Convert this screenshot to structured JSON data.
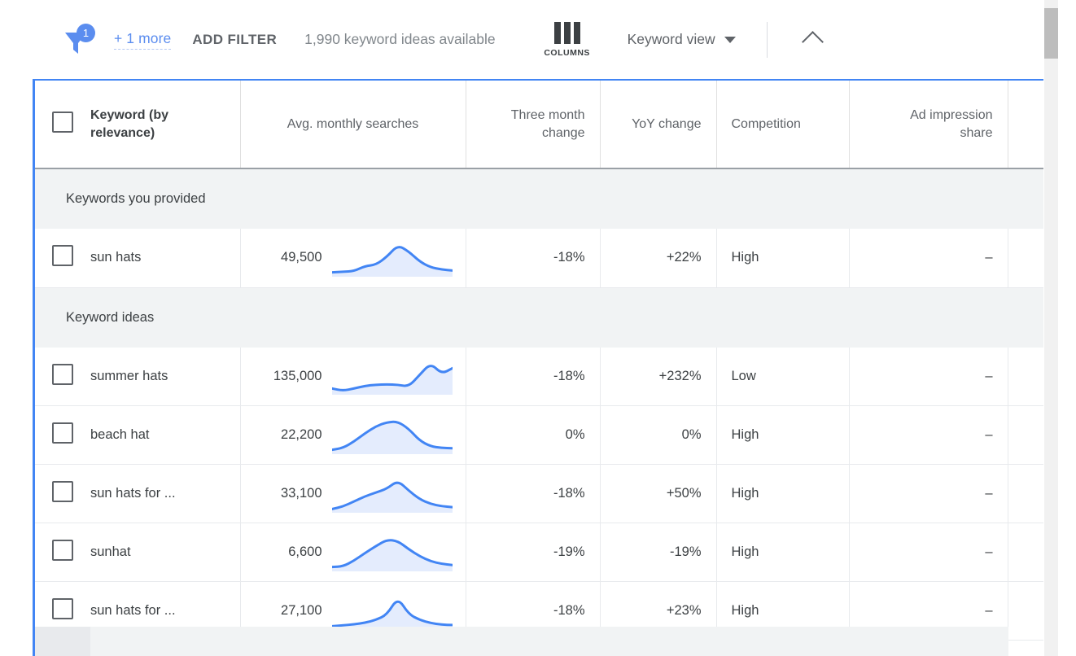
{
  "toolbar": {
    "filter_icon": "filter-funnel-icon",
    "filter_badge_count": "1",
    "more_link": "+ 1 more",
    "add_filter_label": "ADD FILTER",
    "ideas_available": "1,990 keyword ideas available",
    "columns_icon": "columns-icon",
    "columns_label": "COLUMNS",
    "view_label": "Keyword view",
    "view_caret_icon": "chevron-down-icon",
    "collapse_icon": "chevron-up-icon"
  },
  "table": {
    "accent_color": "#4285f4",
    "link_color": "#5b8def",
    "spark_line_color": "#4285f4",
    "spark_fill_color": "#e4ecfd",
    "header_row_bg": "#ffffff",
    "group_row_bg": "#f1f3f4",
    "columns": [
      {
        "key": "check",
        "label": "",
        "align": "center"
      },
      {
        "key": "keyword",
        "label": "Keyword (by relevance)",
        "align": "left"
      },
      {
        "key": "avg",
        "label": "Avg. monthly searches",
        "align": "center"
      },
      {
        "key": "three_month",
        "label": "Three month change",
        "align": "right"
      },
      {
        "key": "yoy",
        "label": "YoY change",
        "align": "right"
      },
      {
        "key": "competition",
        "label": "Competition",
        "align": "left"
      },
      {
        "key": "ad_share",
        "label": "Ad impression share",
        "align": "right"
      }
    ],
    "column_labels": {
      "keyword_line1": "Keyword (by",
      "keyword_line2": "relevance)",
      "avg": "Avg. monthly searches",
      "three_month_line1": "Three month",
      "three_month_line2": "change",
      "yoy": "YoY change",
      "competition": "Competition",
      "ad_line1": "Ad impression",
      "ad_line2": "share"
    },
    "groups": [
      {
        "title": "Keywords you provided",
        "rows": [
          {
            "keyword": "sun hats",
            "avg": "49,500",
            "three_month": "-18%",
            "yoy": "+22%",
            "competition": "High",
            "ad_share": "–",
            "spark": [
              0.06,
              0.08,
              0.1,
              0.26,
              0.3,
              0.55,
              0.92,
              0.72,
              0.4,
              0.22,
              0.15,
              0.12
            ]
          }
        ]
      },
      {
        "title": "Keyword ideas",
        "rows": [
          {
            "keyword": "summer hats",
            "avg": "135,000",
            "three_month": "-18%",
            "yoy": "+232%",
            "competition": "Low",
            "ad_share": "–",
            "spark": [
              0.12,
              0.05,
              0.12,
              0.2,
              0.24,
              0.25,
              0.24,
              0.18,
              0.55,
              0.92,
              0.58,
              0.76
            ]
          },
          {
            "keyword": "beach hat",
            "avg": "22,200",
            "three_month": "0%",
            "yoy": "0%",
            "competition": "High",
            "ad_share": "–",
            "spark": [
              0.06,
              0.12,
              0.32,
              0.58,
              0.8,
              0.93,
              0.95,
              0.72,
              0.35,
              0.17,
              0.12,
              0.11
            ]
          },
          {
            "keyword": "sun hats for ...",
            "avg": "33,100",
            "three_month": "-18%",
            "yoy": "+50%",
            "competition": "High",
            "ad_share": "–",
            "spark": [
              0.04,
              0.12,
              0.28,
              0.44,
              0.56,
              0.68,
              0.94,
              0.62,
              0.35,
              0.2,
              0.13,
              0.1
            ]
          },
          {
            "keyword": "sunhat",
            "avg": "6,600",
            "three_month": "-19%",
            "yoy": "-19%",
            "competition": "High",
            "ad_share": "–",
            "spark": [
              0.06,
              0.08,
              0.26,
              0.5,
              0.72,
              0.92,
              0.88,
              0.62,
              0.4,
              0.24,
              0.16,
              0.12
            ]
          },
          {
            "keyword": "sun hats for ...",
            "avg": "27,100",
            "three_month": "-18%",
            "yoy": "+23%",
            "competition": "High",
            "ad_share": "–",
            "spark": [
              0.04,
              0.07,
              0.1,
              0.15,
              0.24,
              0.4,
              0.95,
              0.42,
              0.24,
              0.14,
              0.09,
              0.08
            ]
          }
        ]
      }
    ]
  },
  "scrollbar": {
    "thumb_color": "#bdbdbd",
    "track_color": "#f1f1f1"
  }
}
